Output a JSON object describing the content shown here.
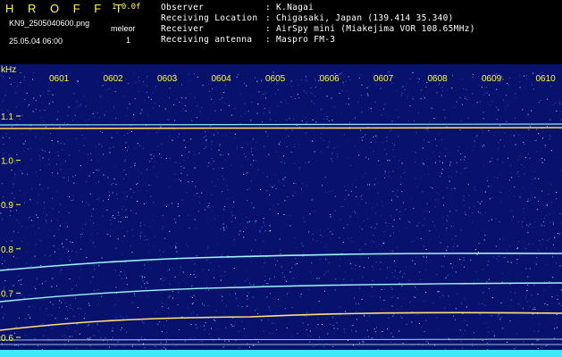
{
  "header": {
    "brand": "H R O F F T",
    "version": "1.0.0f",
    "filename": "KN9_2505040600.png",
    "meleor_label": "meleor",
    "meleor_count": "1",
    "datetime": "25.05.04 06:00",
    "info": [
      {
        "label": "Observer",
        "value": ": K.Nagai"
      },
      {
        "label": "Receiving Location",
        "value": ": Chigasaki, Japan (139.414 35.340)"
      },
      {
        "label": "Receiver",
        "value": ": AirSpy mini (Miakejima VOR 108.65MHz)"
      },
      {
        "label": "Receiving antenna",
        "value": ": Maspro FM-3"
      }
    ]
  },
  "spectrogram": {
    "y_unit": "kHz",
    "y_ticks": [
      "1.1",
      "1.0",
      "0.9",
      "0.8",
      "0.7",
      "0.6"
    ],
    "x_ticks": [
      "0601",
      "0602",
      "0603",
      "0604",
      "0605",
      "0606",
      "0607",
      "0608",
      "0609",
      "0610"
    ],
    "background_color": "#08116b",
    "tick_color": "#ffff2e"
  }
}
